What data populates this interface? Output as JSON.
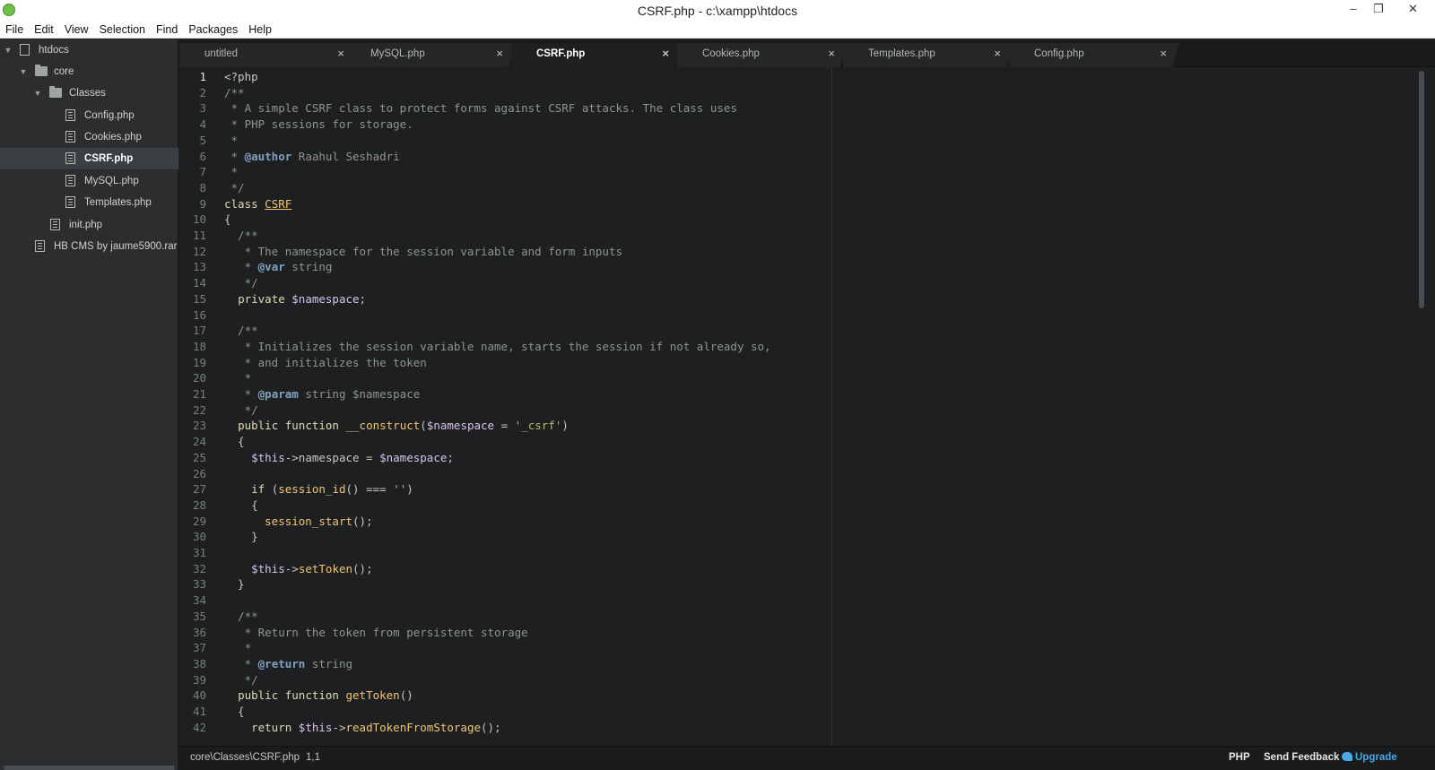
{
  "window": {
    "title": "CSRF.php - c:\\xampp\\htdocs",
    "minimize": "–",
    "maximize": "❐",
    "close": "✕"
  },
  "menu": [
    "File",
    "Edit",
    "View",
    "Selection",
    "Find",
    "Packages",
    "Help"
  ],
  "tree": [
    {
      "label": "htdocs",
      "type": "repo",
      "expanded": true
    },
    {
      "label": "core",
      "type": "folder",
      "expanded": true
    },
    {
      "label": "Classes",
      "type": "folder",
      "expanded": true
    },
    {
      "label": "Config.php",
      "type": "file"
    },
    {
      "label": "Cookies.php",
      "type": "file"
    },
    {
      "label": "CSRF.php",
      "type": "file",
      "selected": true
    },
    {
      "label": "MySQL.php",
      "type": "file"
    },
    {
      "label": "Templates.php",
      "type": "file"
    },
    {
      "label": "init.php",
      "type": "file"
    },
    {
      "label": "HB CMS by jaume5900.rar",
      "type": "file"
    }
  ],
  "tabs": [
    {
      "label": "untitled",
      "close": "×"
    },
    {
      "label": "MySQL.php",
      "close": "×"
    },
    {
      "label": "CSRF.php",
      "close": "×",
      "active": true
    },
    {
      "label": "Cookies.php",
      "close": "×"
    },
    {
      "label": "Templates.php",
      "close": "×"
    },
    {
      "label": "Config.php",
      "close": "×"
    }
  ],
  "code": [
    "<?php",
    "/**",
    " * A simple CSRF class to protect forms against CSRF attacks. The class uses",
    " * PHP sessions for storage.",
    " *",
    " * @author Raahul Seshadri",
    " *",
    " */",
    "class CSRF",
    "{",
    "  /**",
    "   * The namespace for the session variable and form inputs",
    "   * @var string",
    "   */",
    "  private $namespace;",
    "",
    "  /**",
    "   * Initializes the session variable name, starts the session if not already so,",
    "   * and initializes the token",
    "   *",
    "   * @param string $namespace",
    "   */",
    "  public function __construct($namespace = '_csrf')",
    "  {",
    "    $this->namespace = $namespace;",
    "",
    "    if (session_id() === '')",
    "    {",
    "      session_start();",
    "    }",
    "",
    "    $this->setToken();",
    "  }",
    "",
    "  /**",
    "   * Return the token from persistent storage",
    "   *",
    "   * @return string",
    "   */",
    "  public function getToken()",
    "  {",
    "    return $this->readTokenFromStorage();"
  ],
  "status": {
    "path": "core\\Classes\\CSRF.php",
    "cursor": "1,1",
    "grammar": "PHP",
    "feedback": "Send Feedback",
    "upgrade": "Upgrade"
  },
  "colors": {
    "background": "#1d1f21",
    "comment": "#8f9491",
    "keyword": "#e0dbb4",
    "variable": "#d7c4ec",
    "function": "#f0c674",
    "string": "#b5bd68",
    "doc_tag": "#81a2be",
    "upgrade_accent": "#4aa8e6"
  }
}
